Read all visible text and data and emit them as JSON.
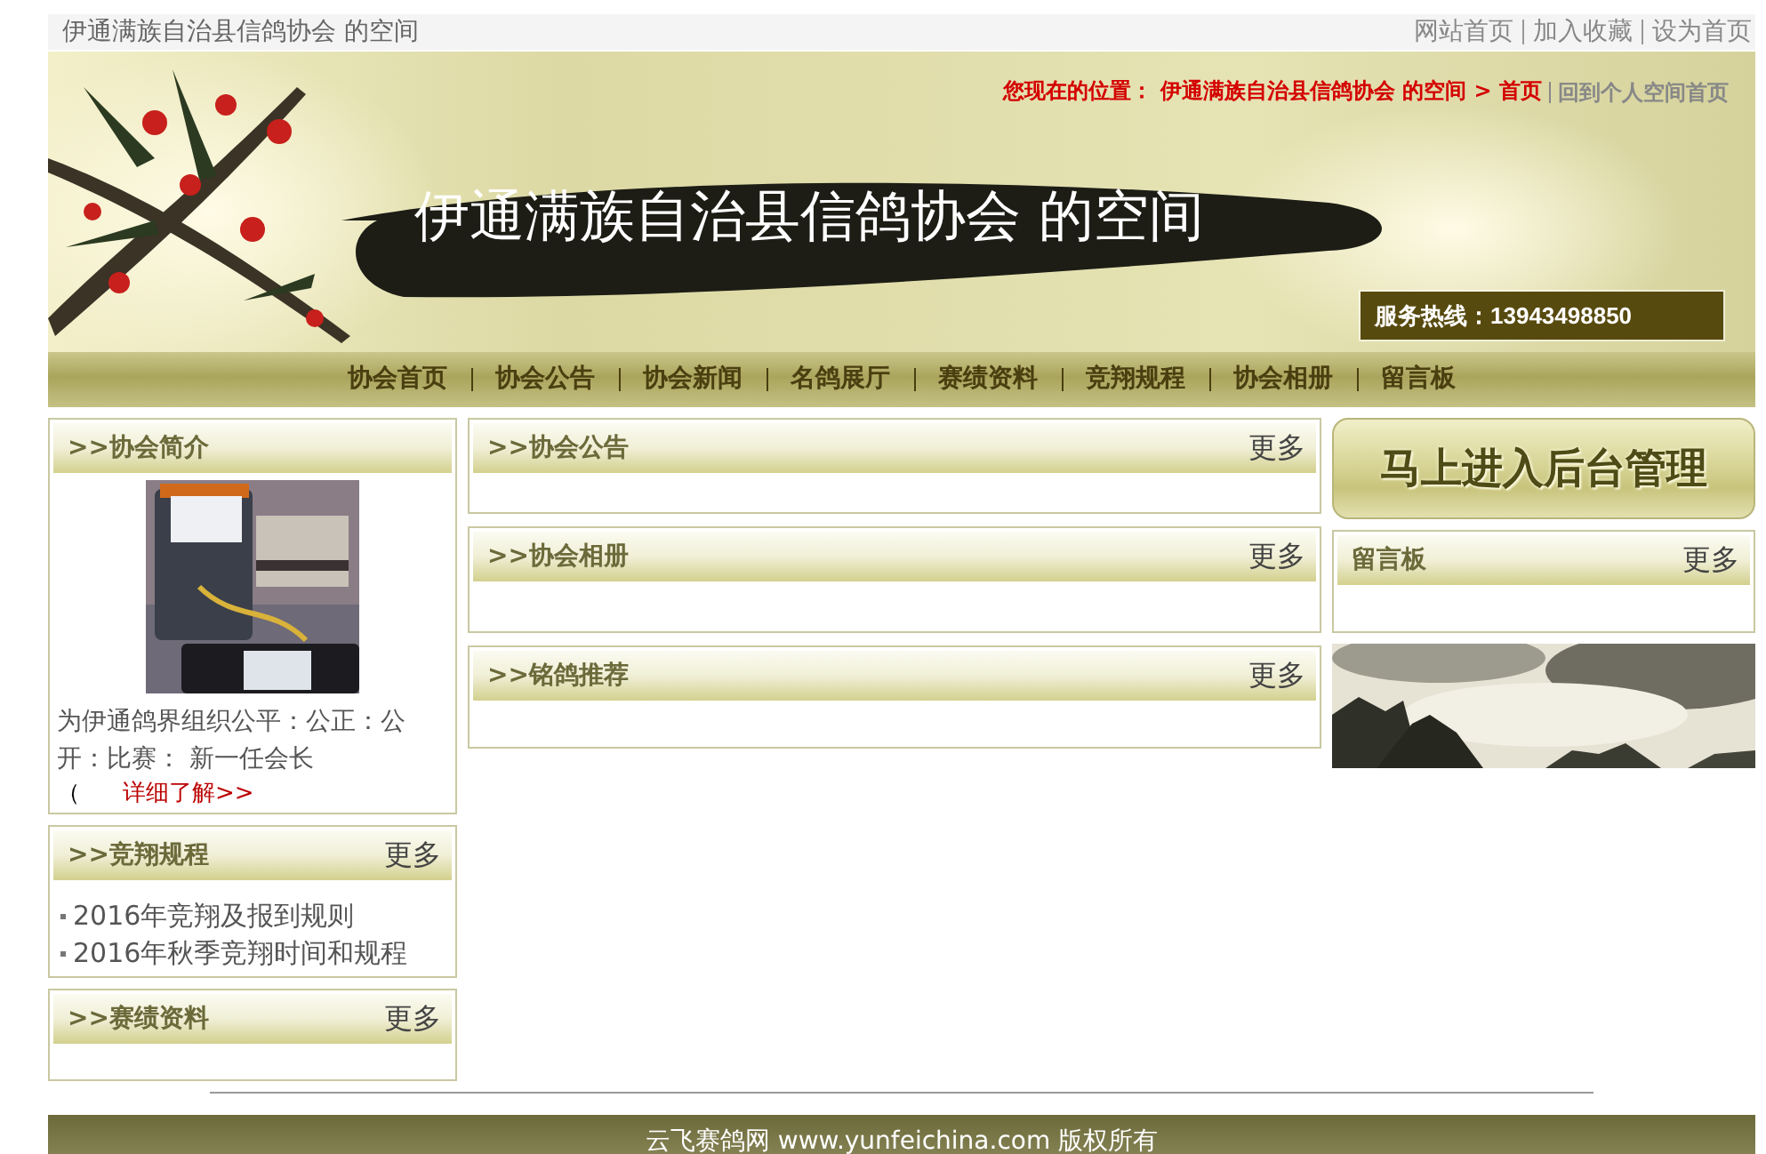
{
  "top_bar": {
    "site_title": "伊通满族自治县信鸽协会 的空间",
    "links": [
      "网站首页",
      "加入收藏",
      "设为首页"
    ]
  },
  "banner": {
    "breadcrumb": "您现在的位置： 伊通满族自治县信鸽协会 的空间 > 首页",
    "back_link": "回到个人空间首页",
    "title": "伊通满族自治县信鸽协会 的空间",
    "hotline": "服务热线：13943498850"
  },
  "nav": {
    "items": [
      "协会首页",
      "协会公告",
      "协会新闻",
      "名鸽展厅",
      "赛绩资料",
      "竞翔规程",
      "协会相册",
      "留言板"
    ]
  },
  "left_panels": [
    {
      "kind": "intro",
      "title": ">>协会简介",
      "text": "为伊通鸽界组织公平：公正：公开：比赛： 新一任会长",
      "detail_prefix": "（",
      "detail_link": "详细了解>>"
    },
    {
      "kind": "list",
      "title": ">>竞翔规程",
      "more": "更多",
      "items": [
        "2016年竞翔及报到规则",
        "2016年秋季竞翔时间和规程"
      ]
    },
    {
      "kind": "list",
      "title": ">>赛绩资料",
      "more": "更多"
    }
  ],
  "middle_panels": [
    {
      "kind": "list",
      "title": ">>协会公告",
      "more": "更多"
    },
    {
      "kind": "list",
      "title": ">>协会相册",
      "more": "更多"
    },
    {
      "kind": "list",
      "title": ">>铭鸽推荐",
      "more": "更多"
    }
  ],
  "right": {
    "admin_button": "马上进入后台管理",
    "panels": [
      {
        "kind": "list",
        "title": "留言板",
        "more": "更多"
      }
    ]
  },
  "footer": {
    "text": "云飞赛鸽网 www.yunfeichina.com 版权所有"
  }
}
